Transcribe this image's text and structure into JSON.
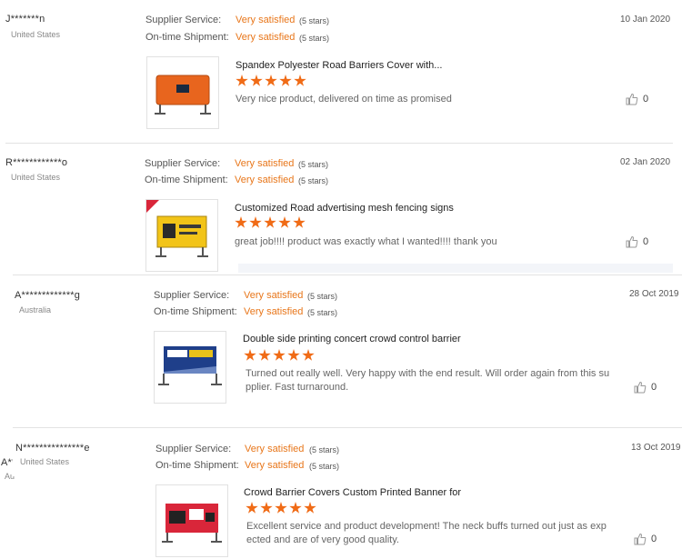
{
  "reviews": [
    {
      "user": "J*******n",
      "country": "United States",
      "date": "10 Jan 2020",
      "supplier_label": "Supplier Service:",
      "supplier_value": "Very satisfied",
      "supplier_stars": "(5 stars)",
      "shipment_label": "On-time Shipment:",
      "shipment_value": "Very satisfied",
      "shipment_stars": "(5 stars)",
      "product_title": "Spandex Polyester Road Barriers Cover with...",
      "rating": 5,
      "comment": "Very nice product, delivered on time as promised",
      "likes": "0",
      "thumb_color": "#e8651e"
    },
    {
      "user": "R************o",
      "country": "United States",
      "date": "02 Jan 2020",
      "supplier_label": "Supplier Service:",
      "supplier_value": "Very satisfied",
      "supplier_stars": "(5 stars)",
      "shipment_label": "On-time Shipment:",
      "shipment_value": "Very satisfied",
      "shipment_stars": "(5 stars)",
      "product_title": "Customized Road advertising mesh fencing signs",
      "rating": 5,
      "comment": "great job!!!! product was exactly what I wanted!!!! thank you",
      "likes": "0",
      "thumb_color": "#f2c418"
    },
    {
      "user": "A*************g",
      "country": "Australia",
      "date": "28 Oct 2019",
      "supplier_label": "Supplier Service:",
      "supplier_value": "Very satisfied",
      "supplier_stars": "(5 stars)",
      "shipment_label": "On-time Shipment:",
      "shipment_value": "Very satisfied",
      "shipment_stars": "(5 stars)",
      "product_title": "Double side printing concert crowd control barrier",
      "rating": 5,
      "comment_line1": "Turned out really well. Very happy with the end result. Will order again from this su",
      "comment_line2": "pplier. Fast turnaround.",
      "likes": "0",
      "thumb_color": "#1f3f8a"
    },
    {
      "user": "N***************e",
      "country": "United States",
      "date": "13 Oct 2019",
      "supplier_label": "Supplier Service:",
      "supplier_value": "Very satisfied",
      "supplier_stars": "(5 stars)",
      "shipment_label": "On-time Shipment:",
      "shipment_value": "Very satisfied",
      "shipment_stars": "(5 stars)",
      "product_title": "Crowd Barrier Covers Custom Printed Banner for",
      "rating": 5,
      "comment_line1": "Excellent service and product development! The neck buffs turned out just as exp",
      "comment_line2": "ected and are of very good quality.",
      "likes": "0",
      "thumb_color": "#d9263a"
    }
  ],
  "overlap": {
    "user_fragment": "A**",
    "country_fragment": "Au"
  }
}
